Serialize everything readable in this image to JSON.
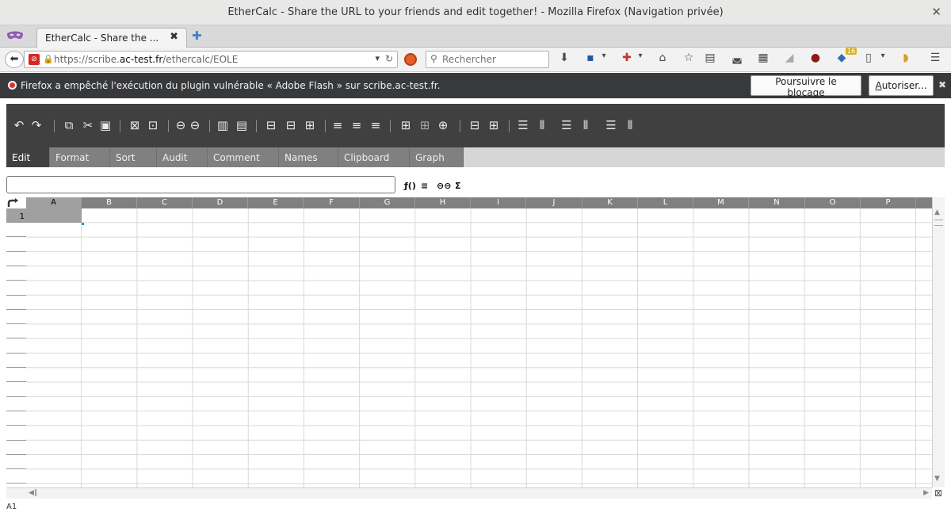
{
  "window": {
    "title": "EtherCalc - Share the URL to your friends and edit together! - Mozilla Firefox (Navigation privée)",
    "close_glyph": "✕"
  },
  "tabbar": {
    "tab_label": "EtherCalc - Share the ...",
    "tab_close": "✖",
    "new_tab_glyph": "✚"
  },
  "navbar": {
    "url_prefix": "https://scribe.",
    "url_domain": "ac-test.fr",
    "url_path": "/ethercalc/EOLE",
    "search_placeholder": "Rechercher",
    "ext_badge": "16"
  },
  "notification": {
    "message": "Firefox a empêché l'exécution du plugin vulnérable « Adobe Flash » sur scribe.ac-test.fr.",
    "continue_block": "Poursuivre le blocage",
    "continue_block_pre": "Poursuivre le ",
    "continue_block_u": "b",
    "continue_block_post": "locage",
    "allow": "Autoriser...",
    "allow_u": "A",
    "allow_post": "utoriser..."
  },
  "app": {
    "tabs": [
      "Edit",
      "Format",
      "Sort",
      "Audit",
      "Comment",
      "Names",
      "Clipboard",
      "Graph"
    ],
    "active_tab": "Edit",
    "formula_value": "",
    "formula_buttons": [
      "ƒ()",
      "≡",
      "⊖⊖",
      "Σ"
    ],
    "columns": [
      "A",
      "B",
      "C",
      "D",
      "E",
      "F",
      "G",
      "H",
      "I",
      "J",
      "K",
      "L",
      "M",
      "N",
      "O",
      "P"
    ],
    "rows": [
      "1",
      "2",
      "3",
      "4",
      "5",
      "6",
      "7",
      "8",
      "9",
      "10",
      "11",
      "12",
      "13",
      "14",
      "15",
      "16",
      "17",
      "18",
      "19"
    ],
    "selected_cell": "A1"
  },
  "status": {
    "cell_ref": "A1"
  }
}
